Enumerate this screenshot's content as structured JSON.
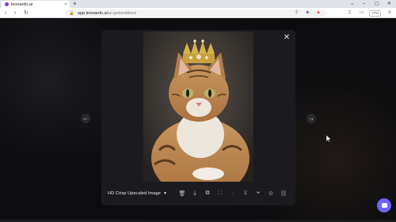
{
  "browser": {
    "tab_title": "leonardo.ai",
    "tab_close_icon": "×",
    "new_tab_icon": "+",
    "url_host": "app.leonardo.ai",
    "url_path": "/ai-generations",
    "vpn_label": "VPN",
    "window_controls": [
      "⌄",
      "–",
      "▢",
      "✕"
    ]
  },
  "modal": {
    "close_icon": "✕",
    "prev_icon": "←",
    "next_icon": "→",
    "model_label": "HD Crisp Upscaled Image",
    "model_caret": "▼",
    "actions": [
      {
        "name": "delete-icon",
        "glyph": "🗑"
      },
      {
        "name": "download-icon",
        "glyph": "⤓"
      },
      {
        "name": "copy-icon",
        "glyph": "⧉"
      },
      {
        "name": "expand-icon",
        "glyph": "⛶"
      },
      {
        "name": "grid-icon",
        "glyph": "⁞"
      },
      {
        "name": "variation-icon",
        "glyph": "⧖"
      },
      {
        "name": "filter-icon",
        "glyph": "⏷"
      },
      {
        "name": "settings-icon",
        "glyph": "⚙"
      },
      {
        "name": "link-icon",
        "glyph": "⛓"
      }
    ]
  },
  "colors": {
    "accent": "#6f63ff",
    "modal_bg": "#1b1b1f"
  }
}
